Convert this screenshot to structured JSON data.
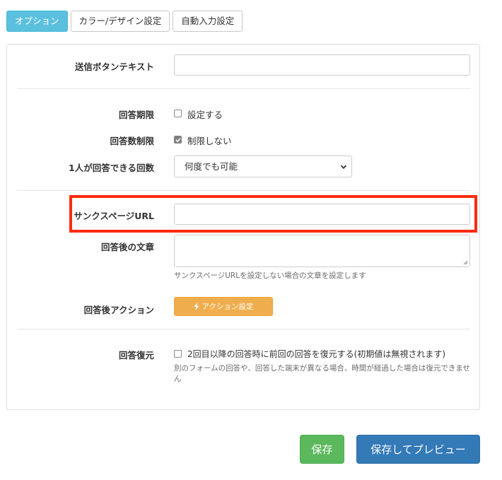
{
  "tabs": [
    {
      "label": "オプション",
      "active": true
    },
    {
      "label": "カラー/デザイン設定",
      "active": false
    },
    {
      "label": "自動入力設定",
      "active": false
    }
  ],
  "form": {
    "submit_text": {
      "label": "送信ボタンテキスト",
      "value": ""
    },
    "deadline": {
      "label": "回答期限",
      "checkbox_label": "設定する",
      "checked": false
    },
    "answer_limit": {
      "label": "回答数制限",
      "checkbox_label": "制限しない",
      "checked": true
    },
    "per_person": {
      "label": "1人が回答できる回数",
      "selected": "何度でも可能"
    },
    "thanks_url": {
      "label": "サンクスページURL",
      "value": ""
    },
    "after_text": {
      "label": "回答後の文章",
      "value": "",
      "help": "サンクスページURLを設定しない場合の文章を設定します"
    },
    "after_action": {
      "label": "回答後アクション",
      "button_label": "アクション設定",
      "icon": "bolt-icon"
    },
    "restore": {
      "label": "回答復元",
      "checkbox_label": "2回目以降の回答時に前回の回答を復元する(初期値は無視されます)",
      "checked": false,
      "help": "別のフォームの回答や、回答した端末が異なる場合、時間が経過した場合は復元できません"
    }
  },
  "footer": {
    "save_label": "保存",
    "preview_label": "保存してプレビュー"
  },
  "colors": {
    "tab_active": "#5bc0de",
    "action": "#f0ad4e",
    "save": "#5cb85c",
    "preview": "#337ab7",
    "highlight": "#ff2a0a"
  }
}
